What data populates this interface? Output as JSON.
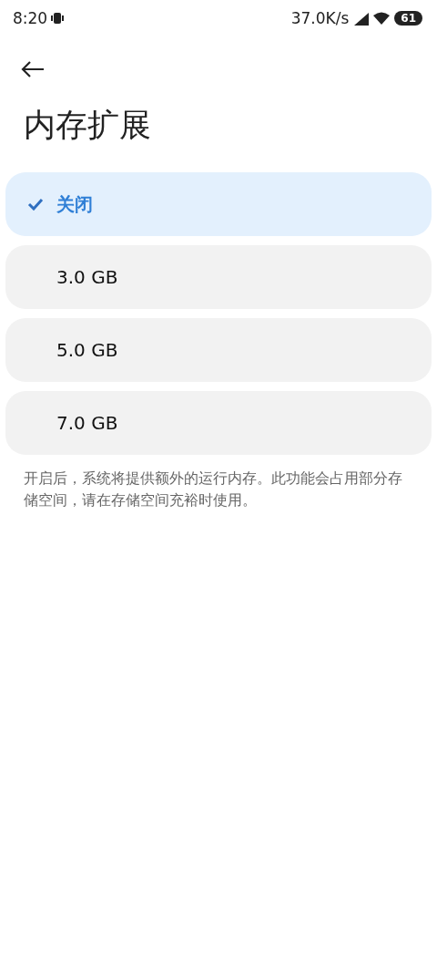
{
  "status_bar": {
    "time": "8:20",
    "speed": "37.0K/s",
    "battery": "61"
  },
  "title": "内存扩展",
  "options": [
    {
      "label": "关闭",
      "selected": true
    },
    {
      "label": "3.0 GB",
      "selected": false
    },
    {
      "label": "5.0 GB",
      "selected": false
    },
    {
      "label": "7.0 GB",
      "selected": false
    }
  ],
  "description": "开启后，系统将提供额外的运行内存。此功能会占用部分存储空间，请在存储空间充裕时使用。"
}
